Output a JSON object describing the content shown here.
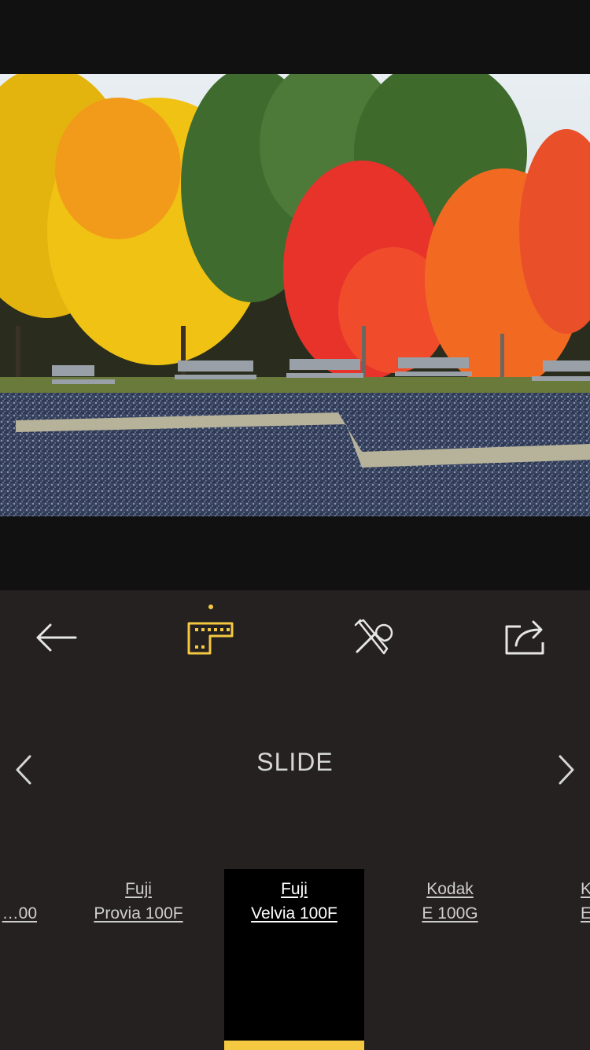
{
  "colors": {
    "accent": "#f5c842",
    "panel": "#242120",
    "background": "#111111",
    "icon": "#e6e6e6"
  },
  "toolbar": {
    "back_icon": "arrow-left-icon",
    "film_icon": "film-icon",
    "tools_icon": "tools-icon",
    "share_icon": "share-icon"
  },
  "category": {
    "label": "SLIDE",
    "prev_icon": "chevron-left-icon",
    "next_icon": "chevron-right-icon"
  },
  "films": [
    {
      "brand": "…",
      "model": "…00",
      "selected": false
    },
    {
      "brand": "Fuji",
      "model": "Provia 100F",
      "selected": false
    },
    {
      "brand": "Fuji",
      "model": "Velvia 100F",
      "selected": true
    },
    {
      "brand": "Kodak",
      "model": "E 100G",
      "selected": false
    },
    {
      "brand": "K…",
      "model": "E…",
      "selected": false
    }
  ]
}
